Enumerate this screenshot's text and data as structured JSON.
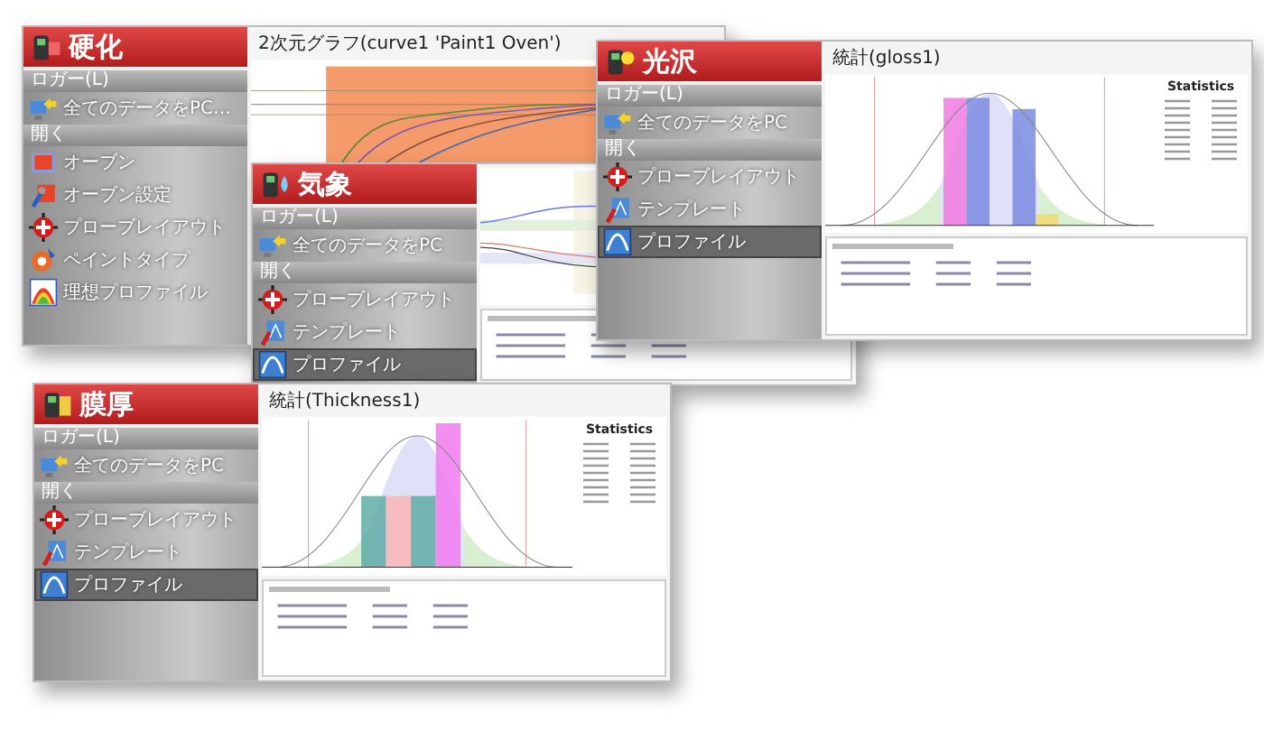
{
  "windows": [
    {
      "kind": "cure",
      "title": "硬化",
      "logger_section": "ロガー(L)",
      "logger_item": "全てのデータをPC…",
      "open_section": "開く",
      "items": [
        {
          "kind": "oven",
          "label": "オーブン",
          "selected": false
        },
        {
          "kind": "oven-settings",
          "label": "オーブン設定",
          "selected": false
        },
        {
          "kind": "probe",
          "label": "プローブレイアウト",
          "selected": false
        },
        {
          "kind": "paint",
          "label": "ペイントタイプ",
          "selected": false
        },
        {
          "kind": "ideal-profile",
          "label": "理想プロファイル",
          "selected": false
        }
      ],
      "chart": {
        "kind": "cure",
        "title": "2次元グラフ(curve1 'Paint1 Oven')"
      }
    },
    {
      "kind": "weather",
      "title": "気象",
      "logger_section": "ロガー(L)",
      "logger_item": "全てのデータをPC",
      "open_section": "開く",
      "items": [
        {
          "kind": "probe",
          "label": "プローブレイアウト",
          "selected": false
        },
        {
          "kind": "template",
          "label": "テンプレート",
          "selected": false
        },
        {
          "kind": "profile",
          "label": "プロファイル",
          "selected": true
        }
      ],
      "chart": {
        "kind": "weather"
      }
    },
    {
      "kind": "gloss",
      "title": "光沢",
      "logger_section": "ロガー(L)",
      "logger_item": "全てのデータをPC",
      "open_section": "開く",
      "items": [
        {
          "kind": "probe",
          "label": "プローブレイアウト",
          "selected": false
        },
        {
          "kind": "template",
          "label": "テンプレート",
          "selected": false
        },
        {
          "kind": "profile",
          "label": "プロファイル",
          "selected": true
        }
      ],
      "chart": {
        "kind": "gloss",
        "title": "統計(gloss1)",
        "statistics_title": "Statistics"
      }
    },
    {
      "kind": "thickness",
      "title": "膜厚",
      "logger_section": "ロガー(L)",
      "logger_item": "全てのデータをPC",
      "open_section": "開く",
      "items": [
        {
          "kind": "probe",
          "label": "プローブレイアウト",
          "selected": false
        },
        {
          "kind": "template",
          "label": "テンプレート",
          "selected": false
        },
        {
          "kind": "profile",
          "label": "プロファイル",
          "selected": true
        }
      ],
      "chart": {
        "kind": "thickness",
        "title": "統計(Thickness1)",
        "statistics_title": "Statistics"
      }
    }
  ]
}
